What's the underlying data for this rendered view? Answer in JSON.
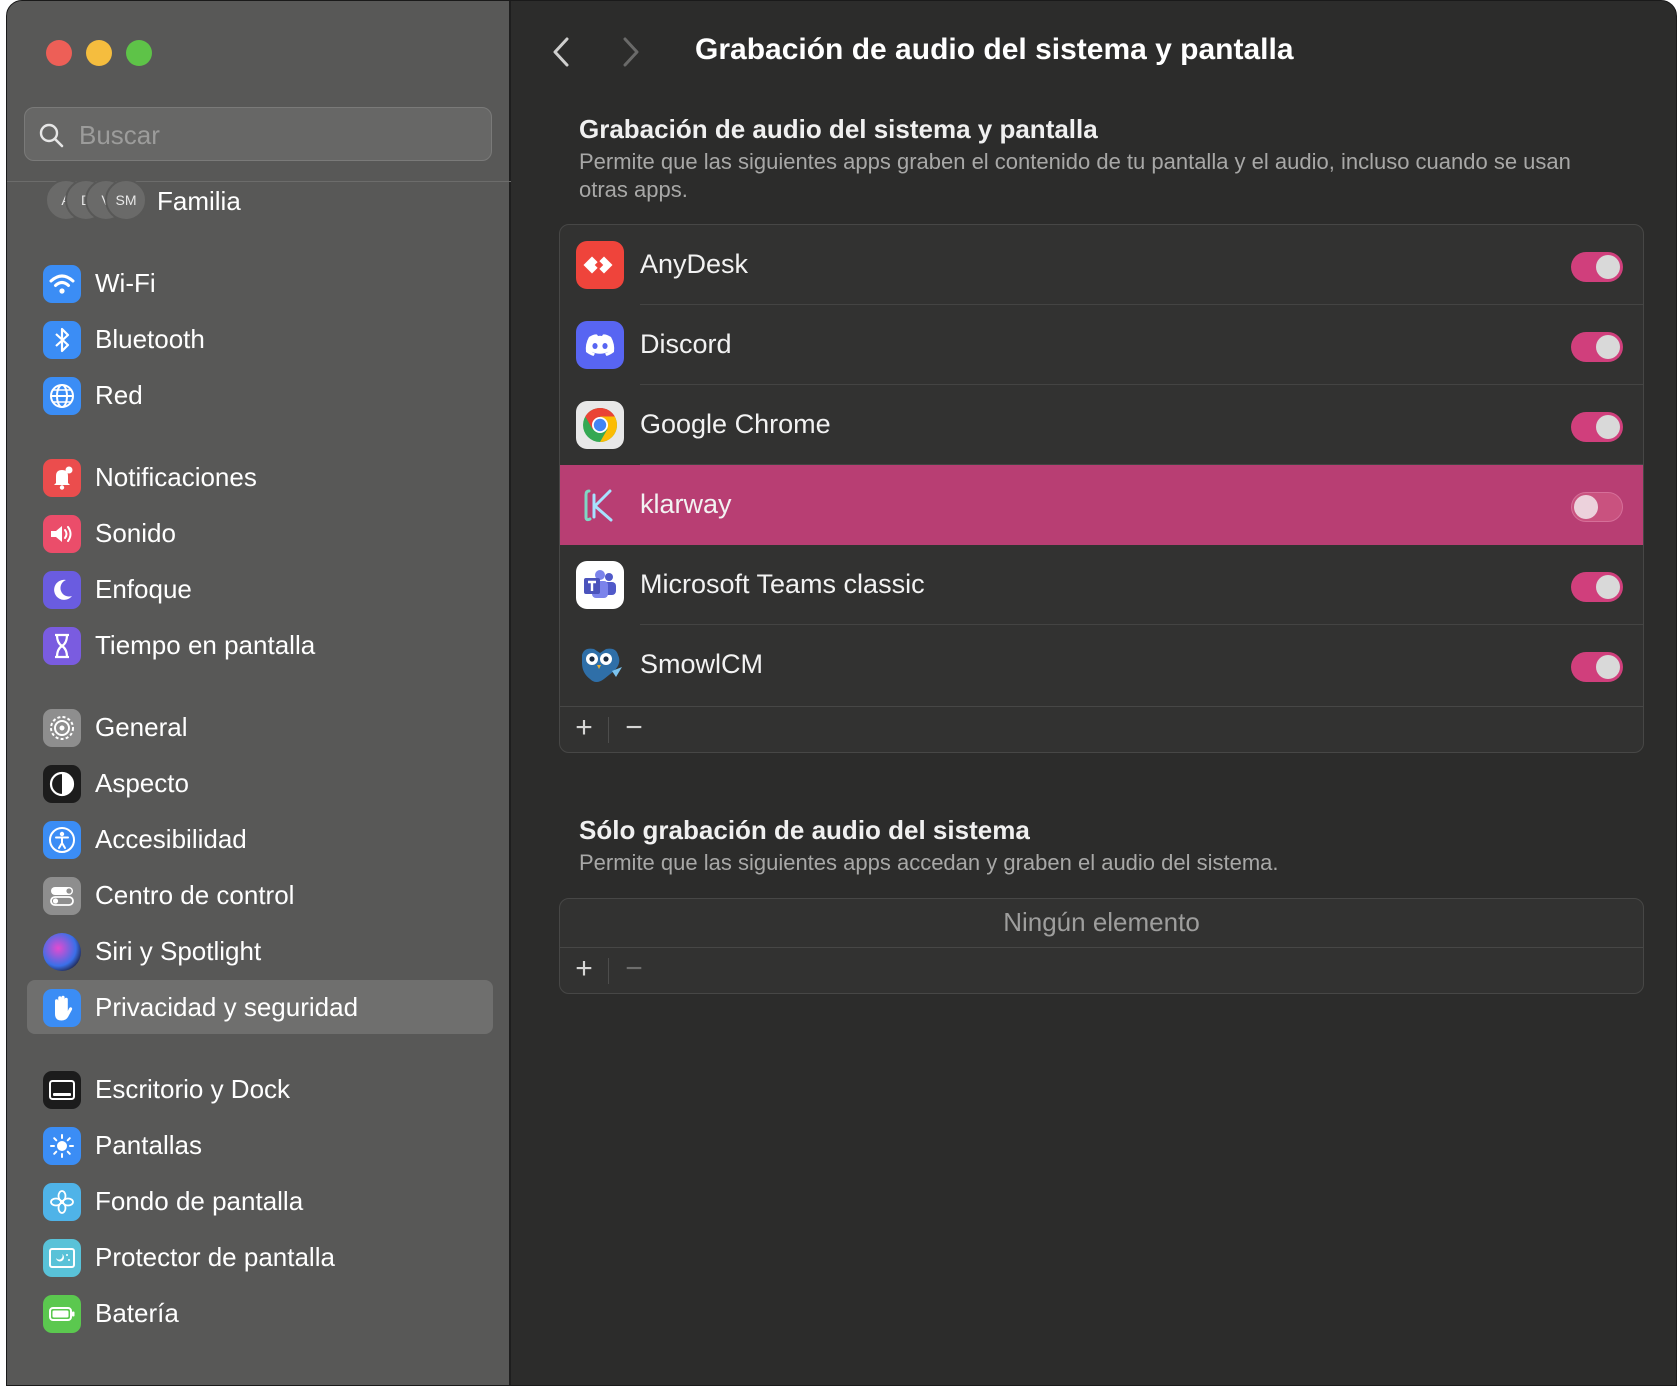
{
  "window": {
    "title": "Grabación de audio del sistema y pantalla"
  },
  "sidebar": {
    "search_placeholder": "Buscar",
    "family": {
      "label": "Familia",
      "avatars": [
        "A",
        "D",
        "V",
        "SM"
      ]
    },
    "items": [
      {
        "label": "Wi-Fi",
        "icon": "wifi-icon",
        "color": "#3b8df5"
      },
      {
        "label": "Bluetooth",
        "icon": "bluetooth-icon",
        "color": "#3b8df5"
      },
      {
        "label": "Red",
        "icon": "globe-icon",
        "color": "#3b8df5"
      },
      {
        "label": "Notificaciones",
        "icon": "bell-icon",
        "color": "#eb4d4d"
      },
      {
        "label": "Sonido",
        "icon": "speaker-icon",
        "color": "#eb4d6a"
      },
      {
        "label": "Enfoque",
        "icon": "moon-icon",
        "color": "#6a5ce0"
      },
      {
        "label": "Tiempo en pantalla",
        "icon": "hourglass-icon",
        "color": "#7a5ce0"
      },
      {
        "label": "General",
        "icon": "gear-icon",
        "color": "#8e8e8e"
      },
      {
        "label": "Aspecto",
        "icon": "appearance-icon",
        "color": "#1c1c1c"
      },
      {
        "label": "Accesibilidad",
        "icon": "accessibility-icon",
        "color": "#3b8df5"
      },
      {
        "label": "Centro de control",
        "icon": "control-center-icon",
        "color": "#8e8e8e"
      },
      {
        "label": "Siri y Spotlight",
        "icon": "siri-icon",
        "color": "#2a2a50"
      },
      {
        "label": "Privacidad y seguridad",
        "icon": "hand-icon",
        "color": "#3b8df5",
        "selected": true
      },
      {
        "label": "Escritorio y Dock",
        "icon": "dock-icon",
        "color": "#1c1c1c"
      },
      {
        "label": "Pantallas",
        "icon": "sun-icon",
        "color": "#3b8df5"
      },
      {
        "label": "Fondo de pantalla",
        "icon": "flower-icon",
        "color": "#4fb3e8"
      },
      {
        "label": "Protector de pantalla",
        "icon": "screensaver-icon",
        "color": "#59c2d8"
      },
      {
        "label": "Batería",
        "icon": "battery-icon",
        "color": "#5bc84f"
      }
    ]
  },
  "main": {
    "nav": {
      "back_icon": "chevron-left-icon",
      "forward_icon": "chevron-right-icon"
    },
    "screen_section": {
      "title": "Grabación de audio del sistema y pantalla",
      "description": "Permite que las siguientes apps graben el contenido de tu pantalla y el audio, incluso cuando se usan otras apps.",
      "apps": [
        {
          "name": "AnyDesk",
          "icon": "anydesk-icon",
          "enabled": true,
          "selected": false
        },
        {
          "name": "Discord",
          "icon": "discord-icon",
          "enabled": true,
          "selected": false
        },
        {
          "name": "Google Chrome",
          "icon": "chrome-icon",
          "enabled": true,
          "selected": false
        },
        {
          "name": "klarway",
          "icon": "klarway-icon",
          "enabled": false,
          "selected": true
        },
        {
          "name": "Microsoft Teams classic",
          "icon": "teams-icon",
          "enabled": true,
          "selected": false
        },
        {
          "name": "SmowlCM",
          "icon": "smowl-owl-icon",
          "enabled": true,
          "selected": false
        }
      ],
      "add_label": "+",
      "remove_label": "−"
    },
    "audio_section": {
      "title": "Sólo grabación de audio del sistema",
      "description": "Permite que las siguientes apps accedan y graben el audio del sistema.",
      "empty_label": "Ningún elemento",
      "add_label": "+",
      "remove_label": "−"
    }
  },
  "colors": {
    "accent": "#d03f7c",
    "selection": "#b83e73",
    "sidebar_bg": "#585857",
    "main_bg": "#2c2c2b"
  }
}
